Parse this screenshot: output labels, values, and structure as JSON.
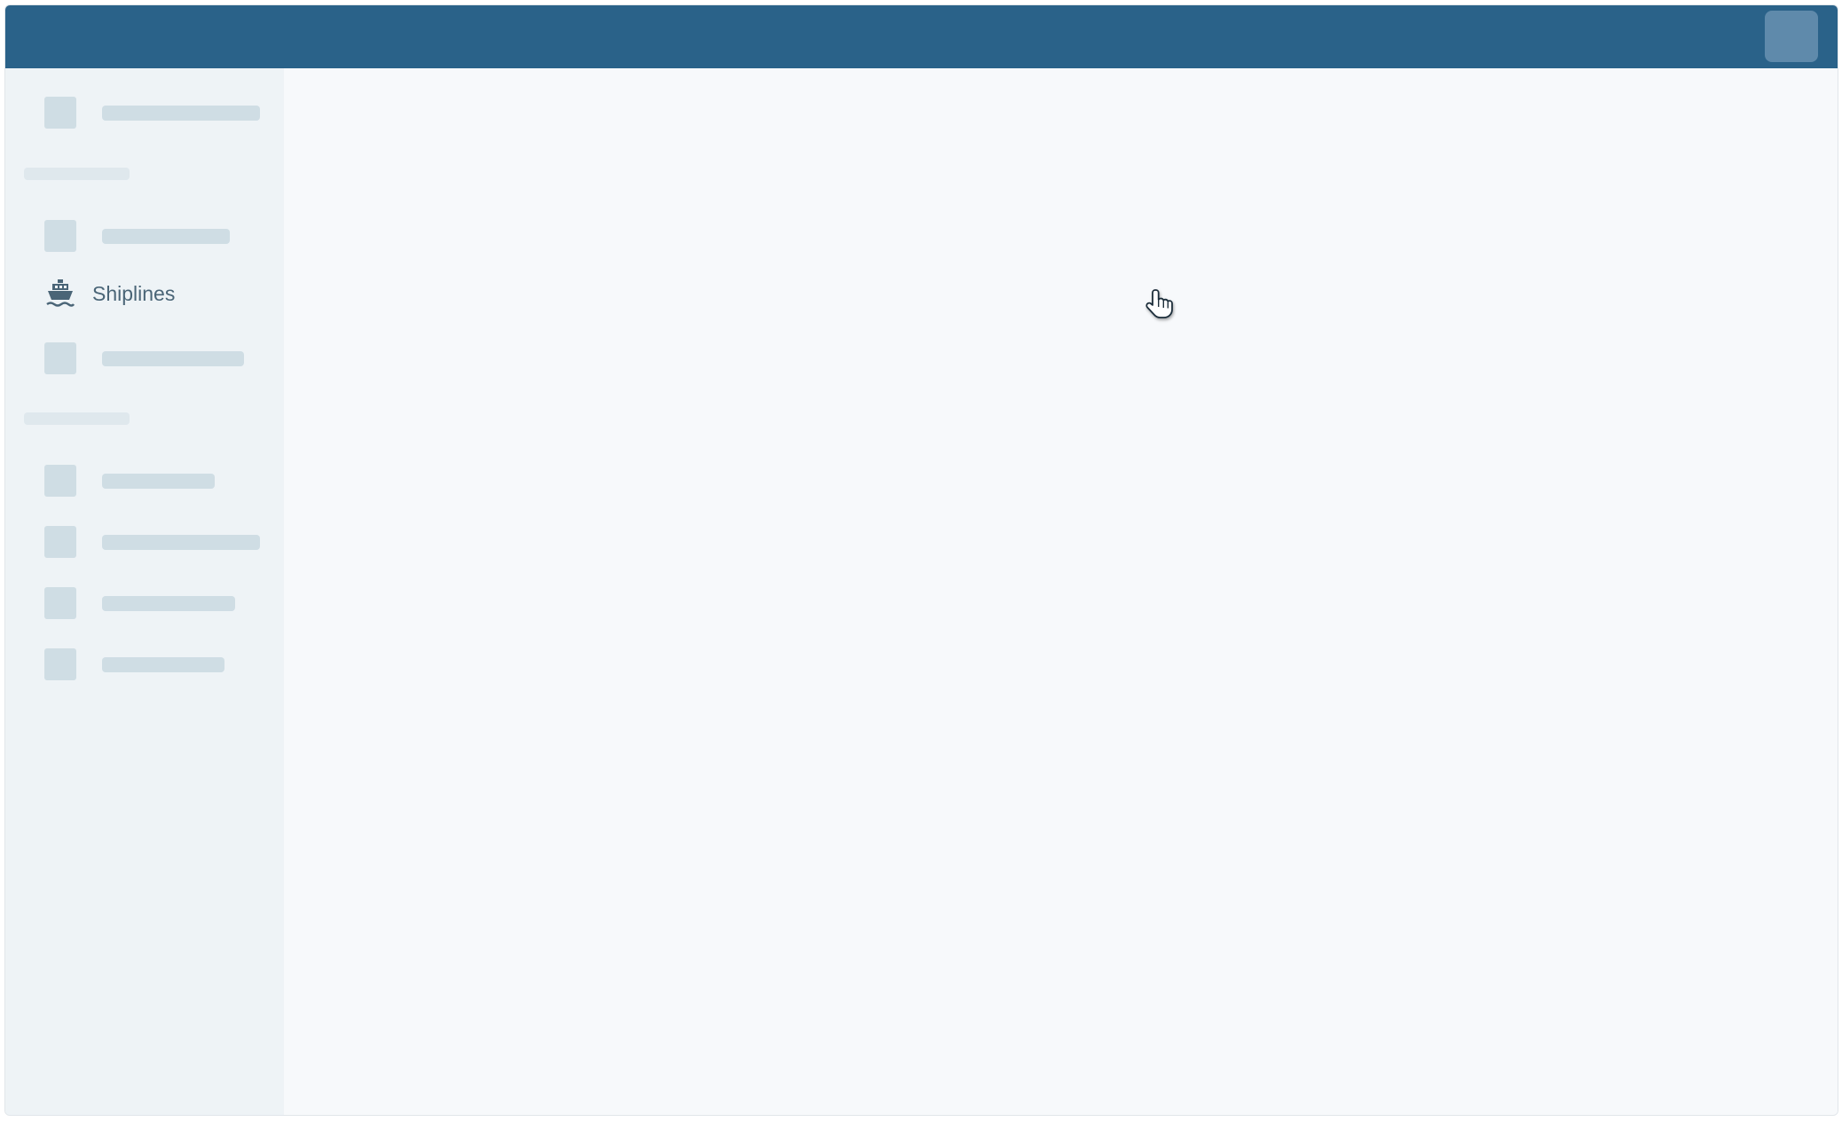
{
  "sidebar": {
    "active_item": {
      "label": "Shiplines",
      "icon": "ship-icon"
    }
  },
  "colors": {
    "top_bar": "#2a6289",
    "top_bar_avatar": "#5f8aab",
    "sidebar_bg": "#eef3f6",
    "main_bg": "#f7f9fb",
    "placeholder": "#cfdde4",
    "active_text": "#4a6577"
  },
  "cursor": {
    "icon": "hand-pointer-icon"
  }
}
